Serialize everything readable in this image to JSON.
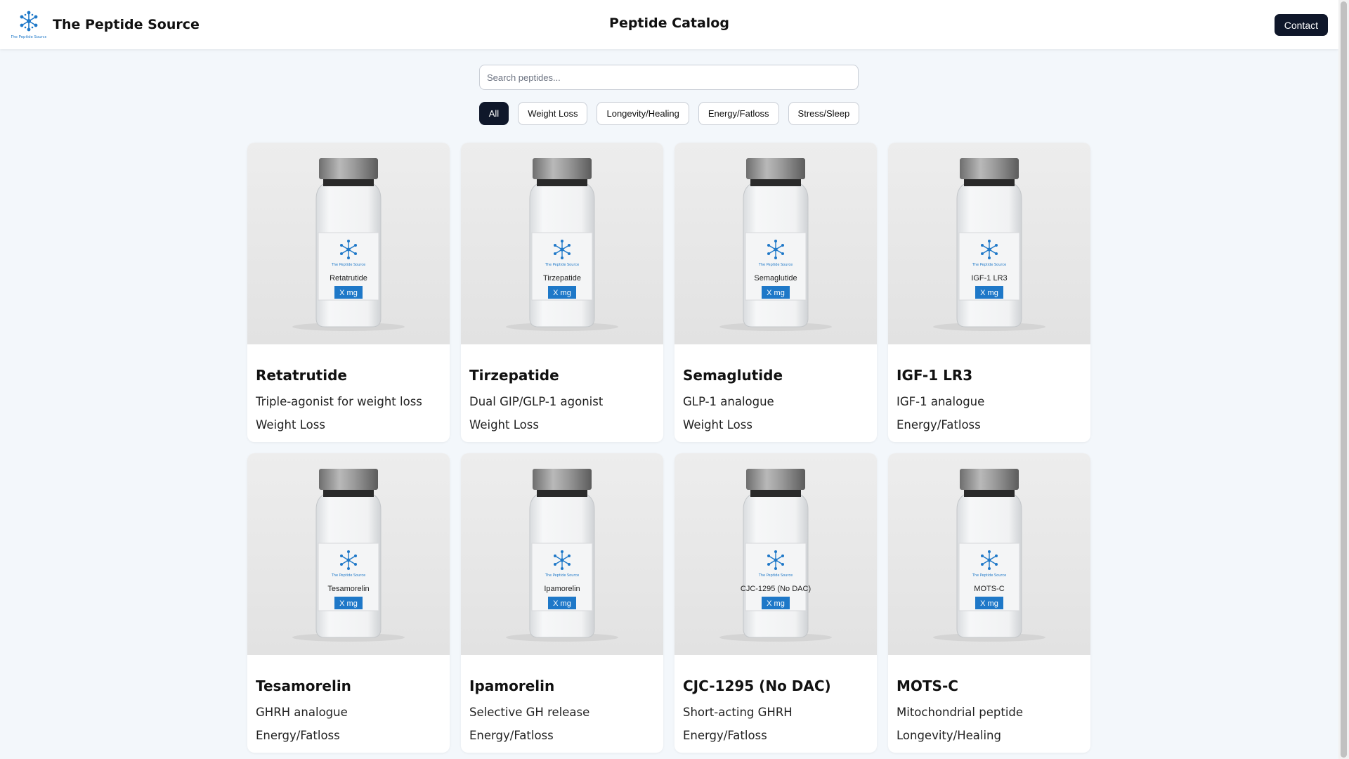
{
  "header": {
    "brand_name": "The Peptide Source",
    "logo_caption": "The Peptide Source",
    "page_title": "Peptide Catalog",
    "contact_label": "Contact"
  },
  "search": {
    "placeholder": "Search peptides...",
    "value": ""
  },
  "filters": [
    {
      "label": "All",
      "active": true
    },
    {
      "label": "Weight Loss",
      "active": false
    },
    {
      "label": "Longevity/Healing",
      "active": false
    },
    {
      "label": "Energy/Fatloss",
      "active": false
    },
    {
      "label": "Stress/Sleep",
      "active": false
    }
  ],
  "vial_dose_label": "X mg",
  "products": [
    {
      "name": "Retatrutide",
      "vial_label": "Retatrutide",
      "description": "Triple-agonist for weight loss",
      "category": "Weight Loss"
    },
    {
      "name": "Tirzepatide",
      "vial_label": "Tirzepatide",
      "description": "Dual GIP/GLP-1 agonist",
      "category": "Weight Loss"
    },
    {
      "name": "Semaglutide",
      "vial_label": "Semaglutide",
      "description": "GLP-1 analogue",
      "category": "Weight Loss"
    },
    {
      "name": "IGF-1 LR3",
      "vial_label": "IGF-1 LR3",
      "description": "IGF-1 analogue",
      "category": "Energy/Fatloss"
    },
    {
      "name": "Tesamorelin",
      "vial_label": "Tesamorelin",
      "description": "GHRH analogue",
      "category": "Energy/Fatloss"
    },
    {
      "name": "Ipamorelin",
      "vial_label": "Ipamorelin",
      "description": "Selective GH release",
      "category": "Energy/Fatloss"
    },
    {
      "name": "CJC-1295 (No DAC)",
      "vial_label": "CJC-1295 (No DAC)",
      "description": "Short-acting GHRH",
      "category": "Energy/Fatloss"
    },
    {
      "name": "MOTS-C",
      "vial_label": "MOTS-C",
      "description": "Mitochondrial peptide",
      "category": "Longevity/Healing"
    }
  ],
  "colors": {
    "accent_dark": "#0f172a",
    "logo_blue": "#1e78c8",
    "page_bg": "#f3f7fb"
  }
}
